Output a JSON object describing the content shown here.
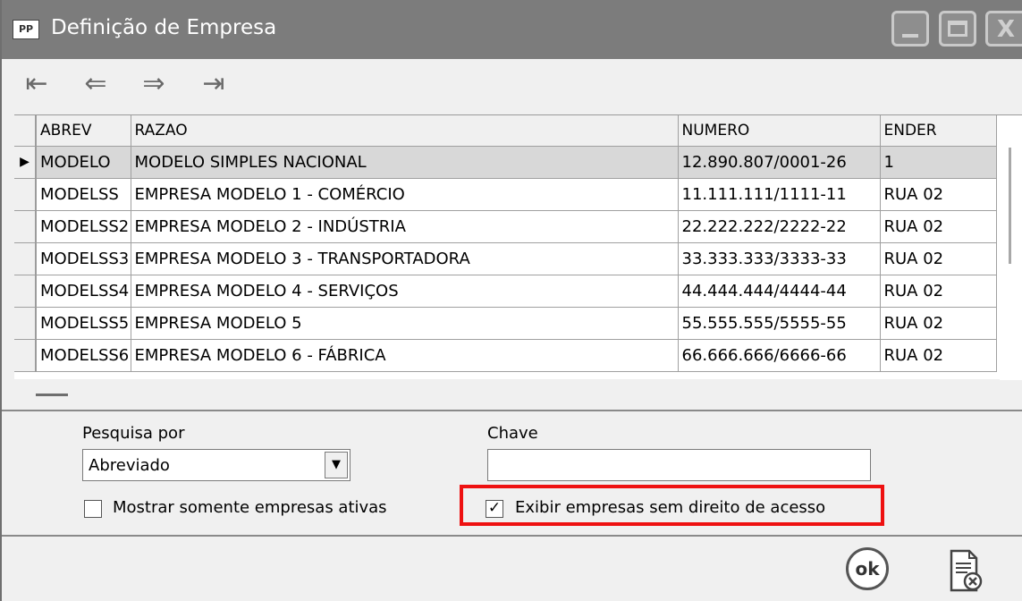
{
  "window": {
    "app_icon": "PP",
    "title": "Definição de Empresa",
    "controls": {
      "minimize": "minimize-icon",
      "maximize": "maximize-icon",
      "close": "close-icon",
      "close_glyph": "X"
    }
  },
  "nav": {
    "first": "⇤",
    "prev": "⇐",
    "next": "⇒",
    "last": "⇥"
  },
  "grid": {
    "columns": [
      "ABREV",
      "RAZAO",
      "NUMERO",
      "ENDER"
    ],
    "selected_indicator": "▶",
    "rows": [
      {
        "abrev": "MODELO",
        "razao": "MODELO SIMPLES NACIONAL",
        "numero": "12.890.807/0001-26",
        "ender": "1",
        "selected": true
      },
      {
        "abrev": "MODELSS",
        "razao": "EMPRESA MODELO 1 - COMÉRCIO",
        "numero": "11.111.111/1111-11",
        "ender": "RUA 02",
        "selected": false
      },
      {
        "abrev": "MODELSS2",
        "razao": "EMPRESA MODELO 2 - INDÚSTRIA",
        "numero": "22.222.222/2222-22",
        "ender": "RUA 02",
        "selected": false
      },
      {
        "abrev": "MODELSS3",
        "razao": "EMPRESA MODELO 3 - TRANSPORTADORA",
        "numero": "33.333.333/3333-33",
        "ender": "RUA 02",
        "selected": false
      },
      {
        "abrev": "MODELSS4",
        "razao": "EMPRESA MODELO 4 - SERVIÇOS",
        "numero": "44.444.444/4444-44",
        "ender": "RUA 02",
        "selected": false
      },
      {
        "abrev": "MODELSS5",
        "razao": "EMPRESA MODELO 5",
        "numero": "55.555.555/5555-55",
        "ender": "RUA 02",
        "selected": false
      },
      {
        "abrev": "MODELSS6",
        "razao": "EMPRESA MODELO 6 - FÁBRICA",
        "numero": "66.666.666/6666-66",
        "ender": "RUA 02",
        "selected": false
      }
    ]
  },
  "search": {
    "pesquisa_label": "Pesquisa por",
    "pesquisa_value": "Abreviado",
    "pesquisa_arrow": "▼",
    "chave_label": "Chave",
    "chave_value": "",
    "only_active_label": "Mostrar somente empresas ativas",
    "only_active_checked": false,
    "show_no_access_label": "Exibir empresas sem direito de acesso",
    "show_no_access_checked": true,
    "check_mark": "✓"
  },
  "footer": {
    "ok_label": "ok",
    "cancel_icon": "cancel-document-icon"
  },
  "colors": {
    "titlebar": "#7c7c7c",
    "highlight": "#e11111",
    "selected_row": "#d8d8d8"
  }
}
